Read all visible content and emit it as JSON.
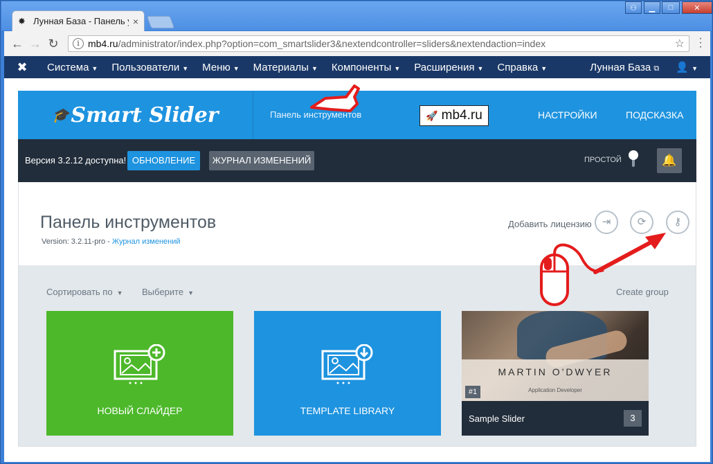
{
  "browser": {
    "tab_title": "Лунная База - Панель у",
    "tab_close": "×",
    "url_host": "mb4.ru",
    "url_path": "/administrator/index.php?option=com_smartslider3&nextendcontroller=sliders&nextendaction=index"
  },
  "admin_nav": {
    "items": [
      {
        "label": "Система"
      },
      {
        "label": "Пользователи"
      },
      {
        "label": "Меню"
      },
      {
        "label": "Материалы"
      },
      {
        "label": "Компоненты"
      },
      {
        "label": "Расширения"
      },
      {
        "label": "Справка"
      }
    ],
    "site_name": "Лунная База"
  },
  "smart_slider": {
    "logo_text": "Smart Slider",
    "dashboard_tab": "Панель инструментов",
    "badge_text": "mb4.ru",
    "settings": "НАСТРОЙКИ",
    "help": "ПОДСКАЗКА"
  },
  "version_bar": {
    "text": "Версия 3.2.12 доступна!",
    "update_button": "ОБНОВЛЕНИЕ",
    "changelog_button": "ЖУРНАЛ ИЗМЕНЕНИЙ",
    "mode_label": "ПРОСТОЙ"
  },
  "dashboard": {
    "title": "Панель инструментов",
    "version_prefix": "Version: 3.2.11-pro - ",
    "version_link": "Журнал изменений",
    "add_license": "Добавить лицензию"
  },
  "sliders": {
    "sort_label": "Сортировать по",
    "select_label": "Выберите",
    "create_group": "Create group",
    "new_slider": "НОВЫЙ СЛАЙДЕР",
    "template_library": "TEMPLATE LIBRARY",
    "sample": {
      "image_name": "MARTIN O'DWYER",
      "image_role": "Application Developer",
      "number": "#1",
      "title": "Sample Slider",
      "count": "3"
    }
  }
}
